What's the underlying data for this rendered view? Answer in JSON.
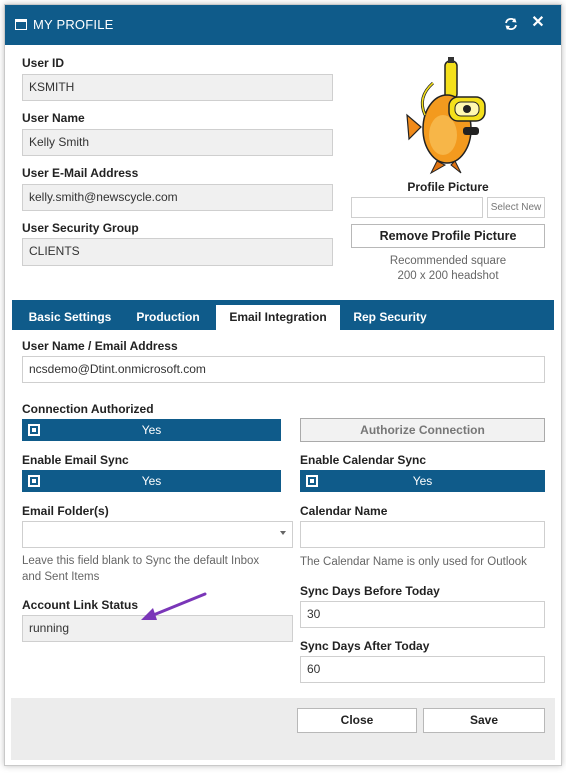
{
  "dialog": {
    "title": "MY PROFILE",
    "icons": {
      "window": "window-icon",
      "refresh": "refresh-icon",
      "close": "close-icon"
    },
    "close_glyph": "✕"
  },
  "profile": {
    "user_id_label": "User ID",
    "user_id_value": "KSMITH",
    "user_name_label": "User Name",
    "user_name_value": "Kelly Smith",
    "email_label": "User E-Mail Address",
    "email_value": "kelly.smith@newscycle.com",
    "security_group_label": "User Security Group",
    "security_group_value": "CLIENTS"
  },
  "picture": {
    "label": "Profile Picture",
    "select_new": "Select New",
    "remove_button": "Remove Profile Picture",
    "hint_line1": "Recommended square",
    "hint_line2": "200 x 200 headshot",
    "image": "scuba-fish-avatar"
  },
  "tabs": [
    {
      "label": "Basic Settings",
      "active": false
    },
    {
      "label": "Production",
      "active": false
    },
    {
      "label": "Email Integration",
      "active": true
    },
    {
      "label": "Rep Security",
      "active": false
    }
  ],
  "email_integration": {
    "username_label": "User Name / Email Address",
    "username_value": "ncsdemo@Dtint.onmicrosoft.com",
    "connection_authorized_label": "Connection Authorized",
    "connection_authorized_value": "Yes",
    "authorize_button": "Authorize Connection",
    "enable_email_sync_label": "Enable Email Sync",
    "enable_email_sync_value": "Yes",
    "enable_calendar_sync_label": "Enable Calendar Sync",
    "enable_calendar_sync_value": "Yes",
    "email_folders_label": "Email Folder(s)",
    "email_folders_value": "",
    "email_folders_hint_line1": "Leave this field blank to Sync the default Inbox",
    "email_folders_hint_line2": "and Sent Items",
    "calendar_name_label": "Calendar Name",
    "calendar_name_value": "",
    "calendar_name_hint": "The Calendar Name is only used for Outlook",
    "account_link_status_label": "Account Link Status",
    "account_link_status_value": "running",
    "sync_days_before_label": "Sync Days Before Today",
    "sync_days_before_value": "30",
    "sync_days_after_label": "Sync Days After Today",
    "sync_days_after_value": "60"
  },
  "footer": {
    "close_button": "Close",
    "save_button": "Save"
  },
  "annotation": {
    "arrow_color": "#7a36b8"
  },
  "colors": {
    "header": "#0f5b8a",
    "accent": "#0f5b8a"
  }
}
